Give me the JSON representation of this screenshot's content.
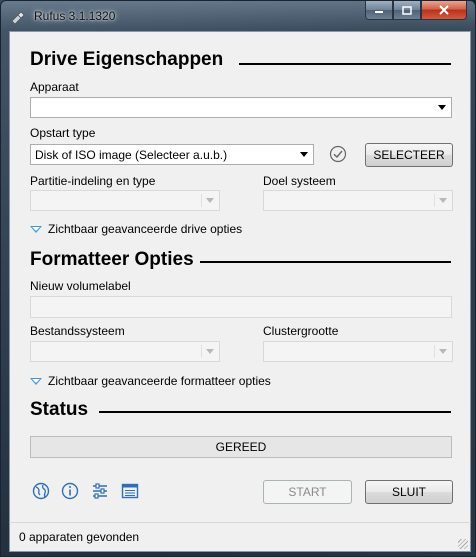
{
  "window": {
    "title": "Rufus 3.1.1320"
  },
  "drive_section": {
    "heading": "Drive Eigenschappen",
    "device_label": "Apparaat",
    "device_value": "",
    "boot_label": "Opstart type",
    "boot_value": "Disk of ISO image (Selecteer a.u.b.)",
    "select_button": "SELECTEER",
    "partition_label": "Partitie-indeling en type",
    "target_label": "Doel systeem",
    "advanced_toggle": "Zichtbaar geavanceerde drive opties"
  },
  "format_section": {
    "heading": "Formatteer Opties",
    "volume_label": "Nieuw volumelabel",
    "volume_value": "",
    "filesystem_label": "Bestandssysteem",
    "cluster_label": "Clustergrootte",
    "advanced_toggle": "Zichtbaar geavanceerde formatteer opties"
  },
  "status_section": {
    "heading": "Status",
    "progress_text": "GEREED",
    "progress_fraction": 0
  },
  "toolbar": {
    "icons": [
      "globe-icon",
      "info-icon",
      "settings-sliders-icon",
      "log-icon"
    ],
    "start_button": "START",
    "close_button": "SLUIT"
  },
  "statusbar": {
    "text": "0 apparaten gevonden"
  },
  "colors": {
    "accent": "#3c9ad6",
    "progress_fill": "#06b025"
  }
}
